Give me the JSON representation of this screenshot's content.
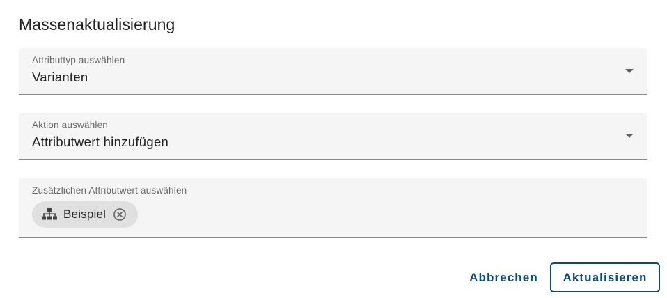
{
  "dialog": {
    "title": "Massenaktualisierung"
  },
  "attribute_type": {
    "label": "Attributtyp auswählen",
    "value": "Varianten",
    "icon": "dropdown-arrow-icon"
  },
  "action": {
    "label": "Aktion auswählen",
    "value": "Attributwert hinzufügen",
    "icon": "dropdown-arrow-icon"
  },
  "additional_value": {
    "label": "Zusätzlichen Attributwert auswählen",
    "chips": [
      {
        "label": "Beispiel",
        "icon": "hierarchy-icon",
        "remove_icon": "close-circle-icon"
      }
    ]
  },
  "buttons": {
    "cancel_label": "Abbrechen",
    "update_label": "Aktualisieren"
  },
  "colors": {
    "accent": "#0d4a6e",
    "field_background": "#f5f5f5",
    "chip_background": "#e0e0e0"
  }
}
